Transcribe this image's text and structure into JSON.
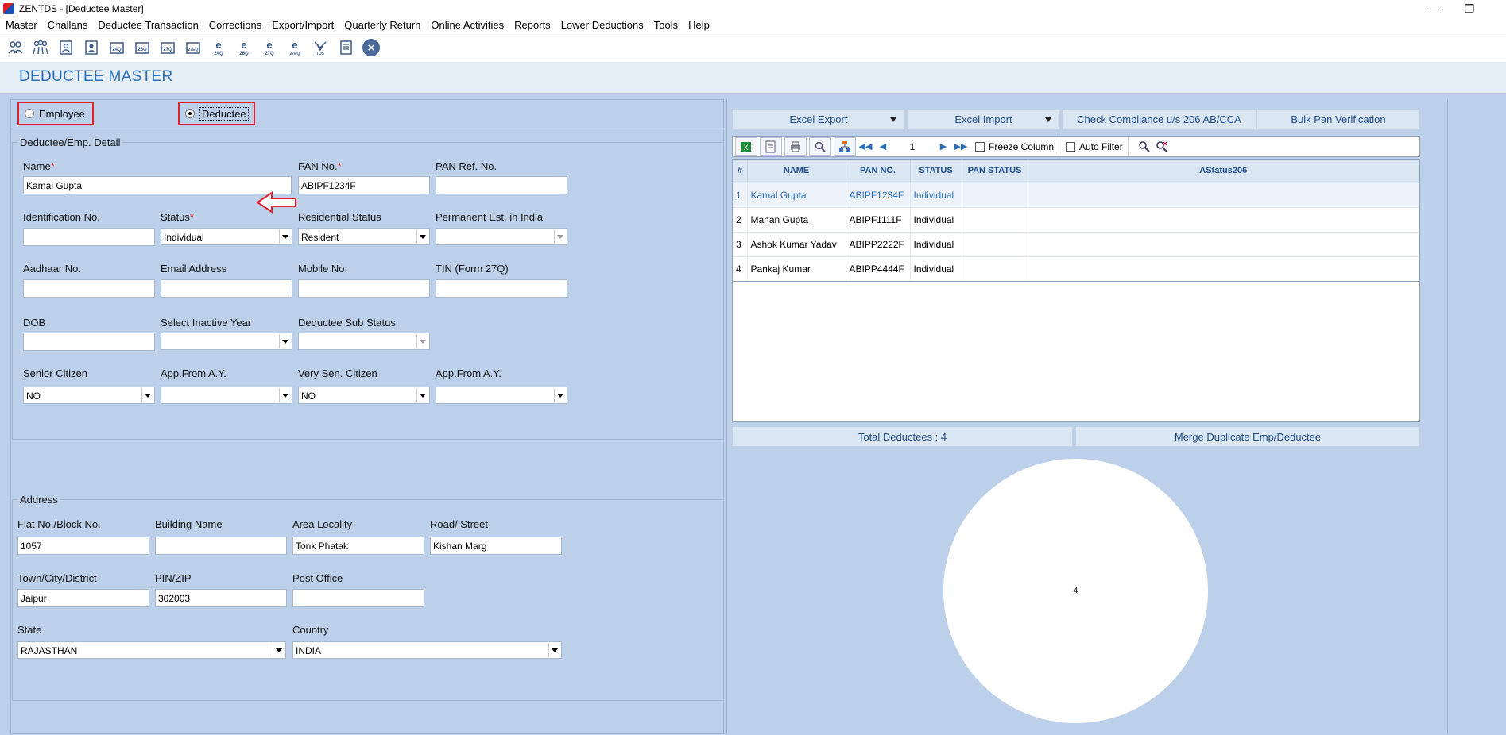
{
  "window": {
    "title": "ZENTDS - [Deductee Master]"
  },
  "menu": [
    "Master",
    "Challans",
    "Deductee Transaction",
    "Corrections",
    "Export/Import",
    "Quarterly Return",
    "Online Activities",
    "Reports",
    "Lower Deductions",
    "Tools",
    "Help"
  ],
  "toolbar": {
    "icons": [
      "users-icon",
      "group-icon",
      "deductor-icon",
      "person-icon",
      "form-24q-icon",
      "form-26q-icon",
      "form-27q-icon",
      "form-27eq-icon",
      "e-24q-icon",
      "e-26q-icon",
      "e-27q-icon",
      "e-27eq-icon",
      "tds-icon",
      "notes-icon",
      "close-icon"
    ],
    "texts": [
      "24Q",
      "26Q",
      "27Q",
      "27EQ",
      "24Q",
      "26Q",
      "27Q",
      "27EQ",
      "TDS"
    ]
  },
  "page": {
    "title": "DEDUCTEE MASTER"
  },
  "type_selector": {
    "employee": "Employee",
    "deductee": "Deductee",
    "selected": "Deductee"
  },
  "detail": {
    "legend": "Deductee/Emp. Detail",
    "name_label": "Name",
    "name": "Kamal Gupta",
    "pan_label": "PAN No.",
    "pan": "ABIPF1234F",
    "pan_ref_label": "PAN Ref. No.",
    "pan_ref": "",
    "ident_label": "Identification No.",
    "ident": "",
    "status_label": "Status",
    "status": "Individual",
    "res_status_label": "Residential Status",
    "res_status": "Resident",
    "perm_est_label": "Permanent Est. in India",
    "perm_est": "",
    "aadhaar_label": "Aadhaar No.",
    "aadhaar": "",
    "email_label": "Email Address",
    "email": "",
    "mobile_label": "Mobile No.",
    "mobile": "",
    "tin_label": "TIN (Form 27Q)",
    "tin": "",
    "dob_label": "DOB",
    "dob": "",
    "inactive_year_label": "Select Inactive Year",
    "inactive_year": "",
    "sub_status_label": "Deductee Sub Status",
    "sub_status": "",
    "senior_label": "Senior Citizen",
    "senior": "NO",
    "app_from_label": "App.From A.Y.",
    "app_from": "",
    "very_senior_label": "Very Sen. Citizen",
    "very_senior": "NO",
    "app_from2_label": "App.From A.Y.",
    "app_from2": ""
  },
  "address": {
    "legend": "Address",
    "flat_label": "Flat No./Block No.",
    "flat": "1057",
    "building_label": "Building Name",
    "building": "",
    "area_label": "Area Locality",
    "area": "Tonk Phatak",
    "road_label": "Road/ Street",
    "road": "Kishan Marg",
    "town_label": "Town/City/District",
    "town": "Jaipur",
    "pin_label": "PIN/ZIP",
    "pin": "302003",
    "post_label": "Post Office",
    "post": "",
    "state_label": "State",
    "state": "RAJASTHAN",
    "country_label": "Country",
    "country": "INDIA"
  },
  "actions": {
    "excel_export": "Excel Export",
    "excel_import": "Excel Import",
    "compliance": "Check Compliance u/s 206 AB/CCA",
    "bulk_pan": "Bulk Pan Verification"
  },
  "grid_toolbar": {
    "page": "1",
    "freeze": "Freeze Column",
    "auto_filter": "Auto Filter"
  },
  "grid": {
    "columns": [
      "#",
      "NAME",
      "PAN NO.",
      "STATUS",
      "PAN STATUS",
      "AStatus206"
    ],
    "rows": [
      [
        "1",
        "Kamal Gupta",
        "ABIPF1234F",
        "Individual",
        "",
        ""
      ],
      [
        "2",
        "Manan Gupta",
        "ABIPF1111F",
        "Individual",
        "",
        ""
      ],
      [
        "3",
        "Ashok Kumar Yadav",
        "ABIPP2222F",
        "Individual",
        "",
        ""
      ],
      [
        "4",
        "Pankaj Kumar",
        "ABIPP4444F",
        "Individual",
        "",
        ""
      ]
    ]
  },
  "footer": {
    "total": "Total Deductees : 4",
    "merge": "Merge Duplicate Emp/Deductee"
  },
  "pie": {
    "label": "4"
  },
  "colors": {
    "accent": "#2a6fb8",
    "workspace": "#bcd0ea",
    "highlight": "#e0202a"
  }
}
